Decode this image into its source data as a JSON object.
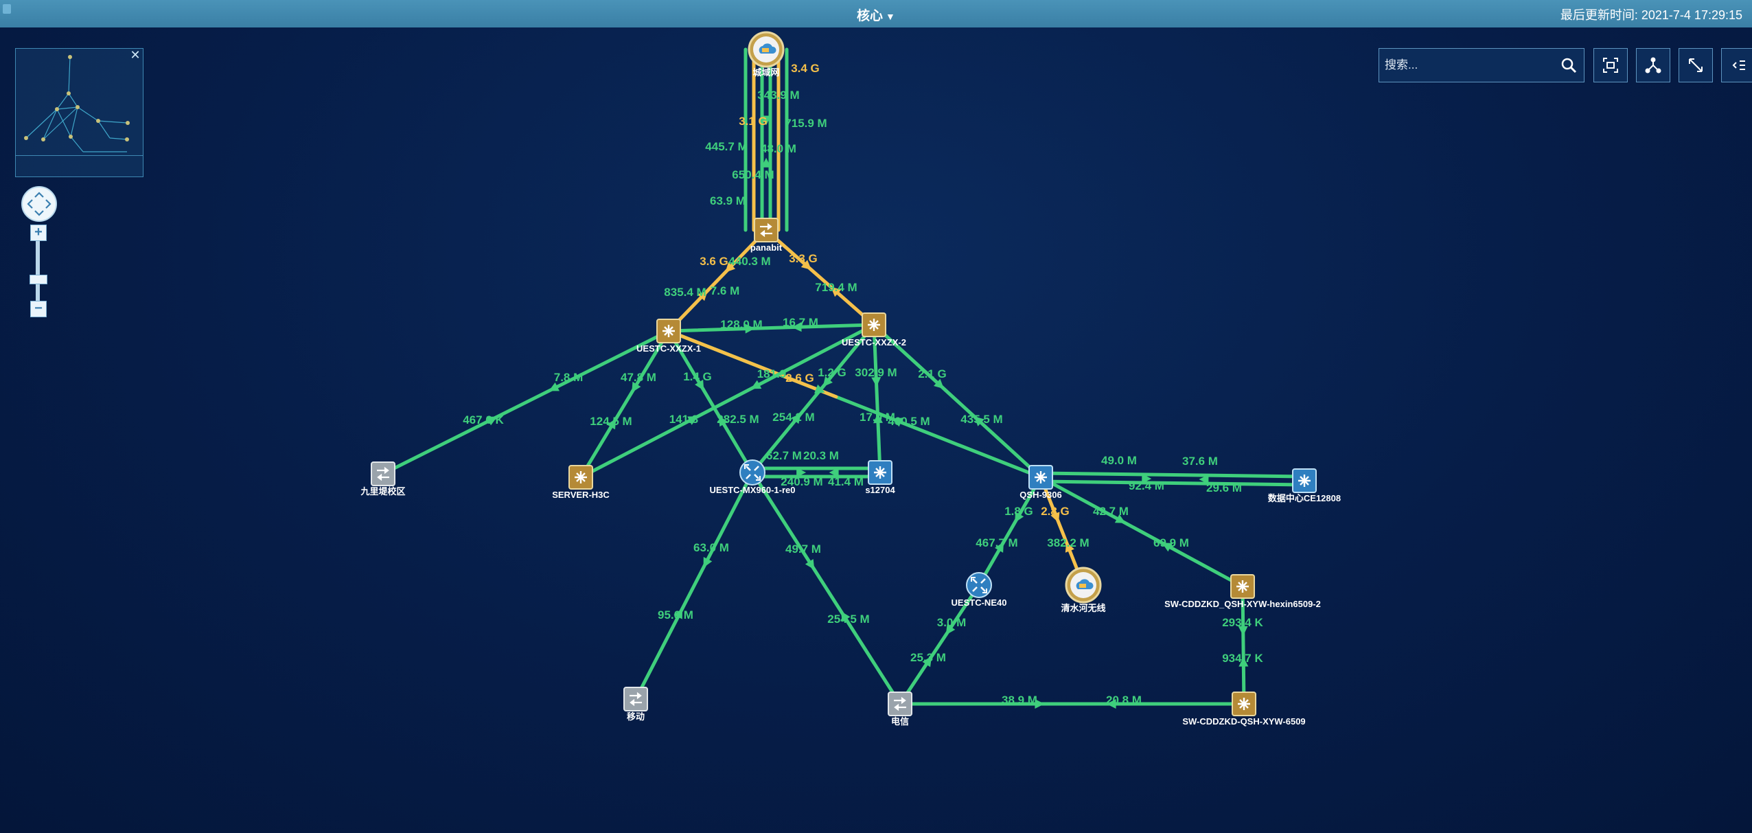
{
  "header": {
    "title": "核心",
    "updated": "最后更新时间: 2021-7-4 17:29:15"
  },
  "search": {
    "placeholder": "搜索..."
  },
  "nodes": [
    {
      "id": "gw",
      "name": "城域网",
      "type": "cloud"
    },
    {
      "id": "panabit",
      "name": "panabit",
      "type": "switch-gold"
    },
    {
      "id": "x1",
      "name": "UESTC-XXZX-1",
      "type": "core-gold"
    },
    {
      "id": "x2",
      "name": "UESTC-XXZX-2",
      "type": "core-gold"
    },
    {
      "id": "jlt",
      "name": "九里堤校区",
      "type": "switch-gray"
    },
    {
      "id": "h3c",
      "name": "SERVER-H3C",
      "type": "core-gold"
    },
    {
      "id": "mx",
      "name": "UESTC-MX960-1-re0",
      "type": "router-blue"
    },
    {
      "id": "s12704",
      "name": "s12704",
      "type": "core-blue"
    },
    {
      "id": "qsh",
      "name": "QSH-9306",
      "type": "core-blue"
    },
    {
      "id": "ce",
      "name": "数据中心CE12808",
      "type": "core-blue"
    },
    {
      "id": "ne40",
      "name": "UESTC-NE40",
      "type": "router-blue"
    },
    {
      "id": "qsw",
      "name": "清水河无线",
      "type": "cloud"
    },
    {
      "id": "sw2",
      "name": "SW-CDDZKD_QSH-XYW-hexin6509-2",
      "type": "core-gold"
    },
    {
      "id": "sw",
      "name": "SW-CDDZKD-QSH-XYW-6509",
      "type": "core-gold"
    },
    {
      "id": "yd",
      "name": "移动",
      "type": "switch-gray"
    },
    {
      "id": "dx",
      "name": "电信",
      "type": "switch-gray"
    }
  ],
  "links": [
    {
      "a": "gw",
      "b": "panabit",
      "labels": [
        {
          "t": "3.4 G",
          "c": "y"
        },
        {
          "t": "343.9 M",
          "c": "g"
        },
        {
          "t": "715.9 M",
          "c": "g"
        },
        {
          "t": "3.1 G",
          "c": "y"
        },
        {
          "t": "445.7 M",
          "c": "g"
        },
        {
          "t": "48.0 M",
          "c": "g"
        },
        {
          "t": "650.4 M",
          "c": "g"
        },
        {
          "t": "63.9 M",
          "c": "g"
        }
      ]
    },
    {
      "a": "panabit",
      "b": "x1",
      "labels": [
        {
          "t": "3.6 G",
          "c": "y"
        },
        {
          "t": "440.3 M",
          "c": "g"
        },
        {
          "t": "835.4 M",
          "c": "g"
        },
        {
          "t": "7.6 M",
          "c": "g"
        }
      ]
    },
    {
      "a": "panabit",
      "b": "x2",
      "labels": [
        {
          "t": "3.3 G",
          "c": "y"
        },
        {
          "t": "719.4 M",
          "c": "g"
        }
      ]
    },
    {
      "a": "x1",
      "b": "x2",
      "labels": [
        {
          "t": "128.0 M",
          "c": "g"
        },
        {
          "t": "16.7 M",
          "c": "g"
        }
      ]
    },
    {
      "a": "x1",
      "b": "jlt",
      "labels": [
        {
          "t": "7.8 M",
          "c": "g"
        },
        {
          "t": "467.6 K",
          "c": "g"
        }
      ]
    },
    {
      "a": "x1",
      "b": "h3c",
      "labels": [
        {
          "t": "47.8 M",
          "c": "g"
        },
        {
          "t": "124.5 M",
          "c": "g"
        }
      ]
    },
    {
      "a": "x1",
      "b": "mx",
      "labels": [
        {
          "t": "1.4 G",
          "c": "g"
        },
        {
          "t": "282.5 M",
          "c": "g"
        }
      ]
    },
    {
      "a": "x1",
      "b": "qsh",
      "labels": [
        {
          "t": "181.9",
          "c": "g"
        },
        {
          "t": "2.6 G",
          "c": "y"
        },
        {
          "t": "460.5 M",
          "c": "g"
        }
      ]
    },
    {
      "a": "x2",
      "b": "h3c",
      "labels": [
        {
          "t": "1.2 G",
          "c": "g"
        },
        {
          "t": "141.3",
          "c": "g"
        }
      ]
    },
    {
      "a": "x2",
      "b": "mx",
      "labels": [
        {
          "t": "254.2 M",
          "c": "g"
        }
      ]
    },
    {
      "a": "x2",
      "b": "s12704",
      "labels": [
        {
          "t": "302.9 M",
          "c": "g"
        },
        {
          "t": "17.0 M",
          "c": "g"
        }
      ]
    },
    {
      "a": "x2",
      "b": "qsh",
      "labels": [
        {
          "t": "2.1 G",
          "c": "g"
        },
        {
          "t": "435.5 M",
          "c": "g"
        }
      ]
    },
    {
      "a": "mx",
      "b": "s12704",
      "labels": [
        {
          "t": "62.7 M",
          "c": "g"
        },
        {
          "t": "20.3 M",
          "c": "g"
        },
        {
          "t": "240.9 M",
          "c": "g"
        },
        {
          "t": "41.4 M",
          "c": "g"
        }
      ]
    },
    {
      "a": "qsh",
      "b": "ce",
      "labels": [
        {
          "t": "49.0 M",
          "c": "g"
        },
        {
          "t": "37.6 M",
          "c": "g"
        },
        {
          "t": "92.4 M",
          "c": "g"
        },
        {
          "t": "29.6 M",
          "c": "g"
        }
      ]
    },
    {
      "a": "qsh",
      "b": "ne40",
      "labels": [
        {
          "t": "1.8 G",
          "c": "g"
        },
        {
          "t": "467.7 M",
          "c": "g"
        }
      ]
    },
    {
      "a": "qsh",
      "b": "qsw",
      "labels": [
        {
          "t": "2.8 G",
          "c": "y"
        },
        {
          "t": "382.2 M",
          "c": "g"
        }
      ]
    },
    {
      "a": "qsh",
      "b": "sw2",
      "labels": [
        {
          "t": "42.7 M",
          "c": "g"
        },
        {
          "t": "69.9 M",
          "c": "g"
        }
      ]
    },
    {
      "a": "mx",
      "b": "yd",
      "labels": [
        {
          "t": "63.0 M",
          "c": "g"
        },
        {
          "t": "95.6 M",
          "c": "g"
        }
      ]
    },
    {
      "a": "mx",
      "b": "dx",
      "labels": [
        {
          "t": "49.7 M",
          "c": "g"
        },
        {
          "t": "254.5 M",
          "c": "g"
        }
      ]
    },
    {
      "a": "ne40",
      "b": "dx",
      "labels": [
        {
          "t": "3.0 M",
          "c": "g"
        },
        {
          "t": "25.3 M",
          "c": "g"
        }
      ]
    },
    {
      "a": "sw2",
      "b": "sw",
      "labels": [
        {
          "t": "293.4 K",
          "c": "g"
        },
        {
          "t": "934.7 K",
          "c": "g"
        }
      ]
    },
    {
      "a": "dx",
      "b": "sw",
      "labels": [
        {
          "t": "38.9 M",
          "c": "g"
        },
        {
          "t": "20.8 M",
          "c": "g"
        }
      ]
    }
  ],
  "colors": {
    "link_green": "#3fcf7c",
    "link_yellow": "#f5c04a",
    "label_white": "#ffffff",
    "topbar": "#3f87ad"
  },
  "icons": [
    "search-icon",
    "fit-view-icon",
    "layout-icon",
    "fullscreen-icon",
    "panel-toggle-icon",
    "minimap-close-icon",
    "pan-control-icon",
    "zoom-in-icon",
    "zoom-out-icon"
  ]
}
